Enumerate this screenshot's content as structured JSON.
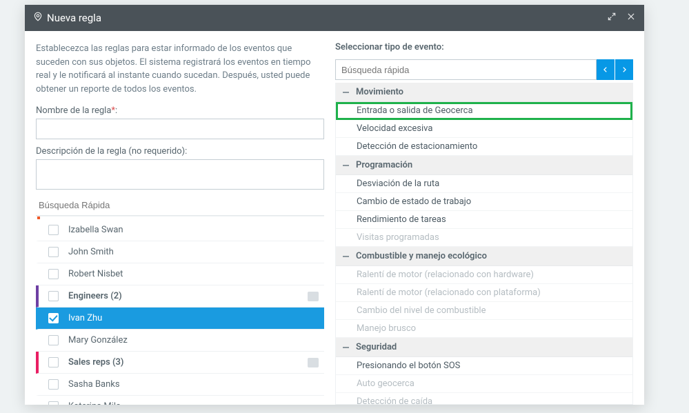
{
  "titlebar": {
    "title": "Nueva regla"
  },
  "left": {
    "intro": "Establecezca las reglas para estar informado de los eventos que suceden con sus objetos. El sistema registrará los eventos en tiempo real y le notificará al instante cuando sucedan. Después, usted puede obtener un reporte de todos los eventos.",
    "rule_name_label": "Nombre de la regla",
    "req": "*",
    "colon": ":",
    "rule_desc_label": "Descripción de la regla (no requerido):",
    "search_placeholder": "Búsqueda Rápida",
    "list": [
      {
        "kind": "item",
        "label": "Izabella Swan"
      },
      {
        "kind": "item",
        "label": "John Smith"
      },
      {
        "kind": "item",
        "label": "Robert Nisbet"
      },
      {
        "kind": "group",
        "label": "Engineers (2)",
        "color": "purple"
      },
      {
        "kind": "item",
        "label": "Ivan Zhu",
        "selected": true,
        "checked": true
      },
      {
        "kind": "item",
        "label": "Mary González"
      },
      {
        "kind": "group",
        "label": "Sales reps (3)",
        "color": "pink"
      },
      {
        "kind": "item",
        "label": "Sasha Banks"
      },
      {
        "kind": "item",
        "label": "Katerina Mila"
      }
    ]
  },
  "right": {
    "section_label": "Seleccionar tipo de evento:",
    "search_placeholder": "Búsqueda rápida",
    "groups": [
      {
        "title": "Movimiento",
        "items": [
          {
            "label": "Entrada o salida de Geocerca",
            "highlight": true
          },
          {
            "label": "Velocidad excesiva"
          },
          {
            "label": "Detección de estacionamiento"
          }
        ]
      },
      {
        "title": "Programación",
        "items": [
          {
            "label": "Desviación de la ruta"
          },
          {
            "label": "Cambio de estado de trabajo"
          },
          {
            "label": "Rendimiento de tareas"
          },
          {
            "label": "Visitas programadas",
            "disabled": true
          }
        ]
      },
      {
        "title": "Combustible y manejo ecológico",
        "items": [
          {
            "label": "Ralentí de motor (relacionado con hardware)",
            "disabled": true
          },
          {
            "label": "Ralentí de motor (relacionado con plataforma)",
            "disabled": true
          },
          {
            "label": "Cambio del nivel de combustible",
            "disabled": true
          },
          {
            "label": "Manejo brusco",
            "disabled": true
          }
        ]
      },
      {
        "title": "Seguridad",
        "items": [
          {
            "label": "Presionando el botón SOS"
          },
          {
            "label": "Auto geocerca",
            "disabled": true
          },
          {
            "label": "Detección de caída",
            "disabled": true
          }
        ]
      }
    ]
  }
}
